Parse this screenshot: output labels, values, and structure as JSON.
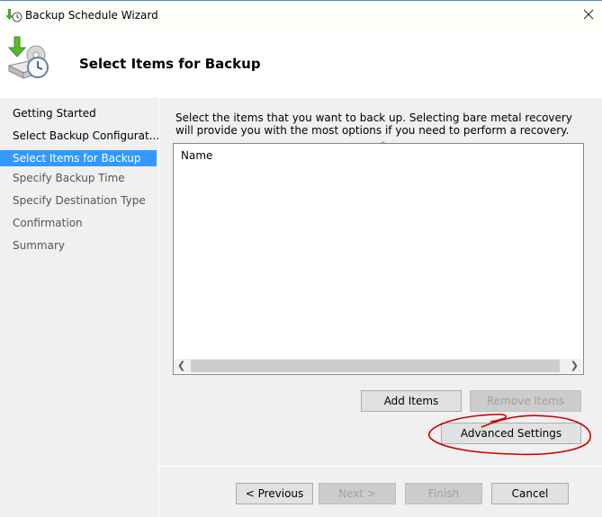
{
  "window": {
    "title": "Backup Schedule Wizard",
    "close_icon": "close-icon"
  },
  "header": {
    "title": "Select Items for Backup",
    "icon": "backup-schedule-icon"
  },
  "sidebar": {
    "items": [
      {
        "label": "Getting Started",
        "state": "done"
      },
      {
        "label": "Select Backup Configurat...",
        "state": "done"
      },
      {
        "label": "Select Items for Backup",
        "state": "active"
      },
      {
        "label": "Specify Backup Time",
        "state": "pending"
      },
      {
        "label": "Specify Destination Type",
        "state": "pending"
      },
      {
        "label": "Confirmation",
        "state": "pending"
      },
      {
        "label": "Summary",
        "state": "pending"
      }
    ]
  },
  "main": {
    "description": "Select the items that you want to back up. Selecting bare metal recovery will provide you with the most options if you need to perform a recovery.",
    "list": {
      "column_header": "Name",
      "sort_indicator": "^",
      "rows": []
    },
    "buttons": {
      "add_items": "Add Items",
      "remove_items": "Remove Items",
      "advanced_settings": "Advanced Settings"
    }
  },
  "footer": {
    "previous": "< Previous",
    "next": "Next >",
    "finish": "Finish",
    "cancel": "Cancel"
  },
  "colors": {
    "selection": "#3399ff",
    "annotation": "#cc0000"
  }
}
